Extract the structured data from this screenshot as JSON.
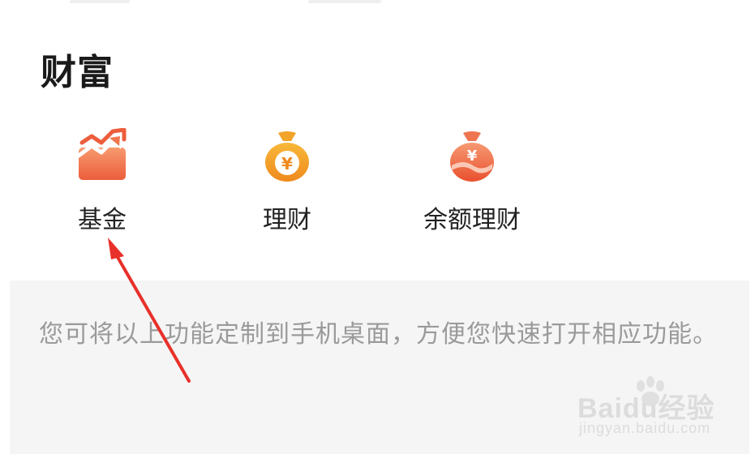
{
  "section": {
    "title": "财富"
  },
  "features": [
    {
      "label": "基金",
      "icon": "fund-chart-icon"
    },
    {
      "label": "理财",
      "icon": "money-bag-icon"
    },
    {
      "label": "余额理财",
      "icon": "money-bag-wave-icon"
    }
  ],
  "hint": {
    "text": "您可将以上功能定制到手机桌面，方便您快速打开相应功能。"
  },
  "watermark": {
    "brand": "Baidu经验",
    "url": "jingyan.baidu.com"
  },
  "colors": {
    "accent_orange": "#f0774d",
    "icon_yellow": "#f5a623",
    "arrow_red": "#e8302a",
    "hint_bg": "#f5f5f5",
    "hint_text": "#9a9a9a"
  }
}
